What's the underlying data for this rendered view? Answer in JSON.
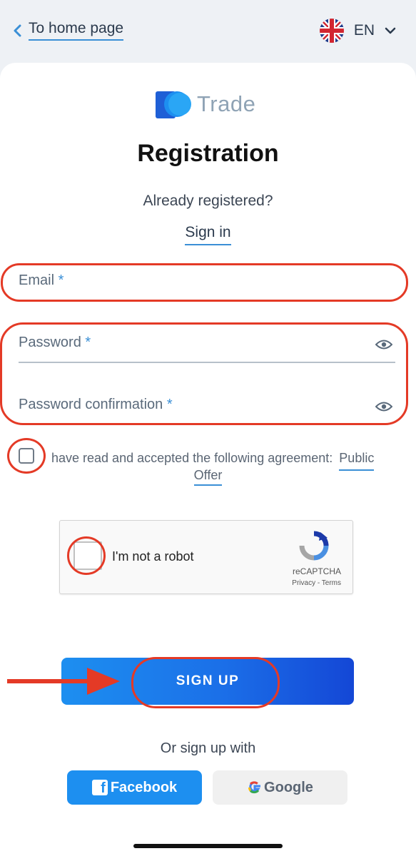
{
  "header": {
    "back_label": "To home page",
    "lang_code": "EN"
  },
  "brand": {
    "name": "Trade"
  },
  "form": {
    "title": "Registration",
    "already_registered": "Already registered?",
    "sign_in_link": "Sign in",
    "email_label": "Email",
    "password_label": "Password",
    "password_confirm_label": "Password confirmation",
    "required_mark": "*",
    "agreement_text": "have read and accepted the following agreement:",
    "agreement_link_part1": "Public",
    "agreement_link_part2": "Offer"
  },
  "captcha": {
    "label": "I'm not a robot",
    "brand": "reCAPTCHA",
    "links": "Privacy - Terms"
  },
  "actions": {
    "signup_label": "SIGN UP",
    "or_sign_up_with": "Or sign up with",
    "facebook_label": "Facebook",
    "google_label": "Google"
  },
  "colors": {
    "accent_blue": "#1d8ff0",
    "annotation_red": "#e43a26",
    "underline_blue": "#3a8fd6"
  },
  "icons": [
    "chevron-left-icon",
    "uk-flag-icon",
    "chevron-down-icon",
    "eye-icon",
    "recaptcha-icon",
    "facebook-icon",
    "google-icon",
    "arrow-right-icon"
  ]
}
